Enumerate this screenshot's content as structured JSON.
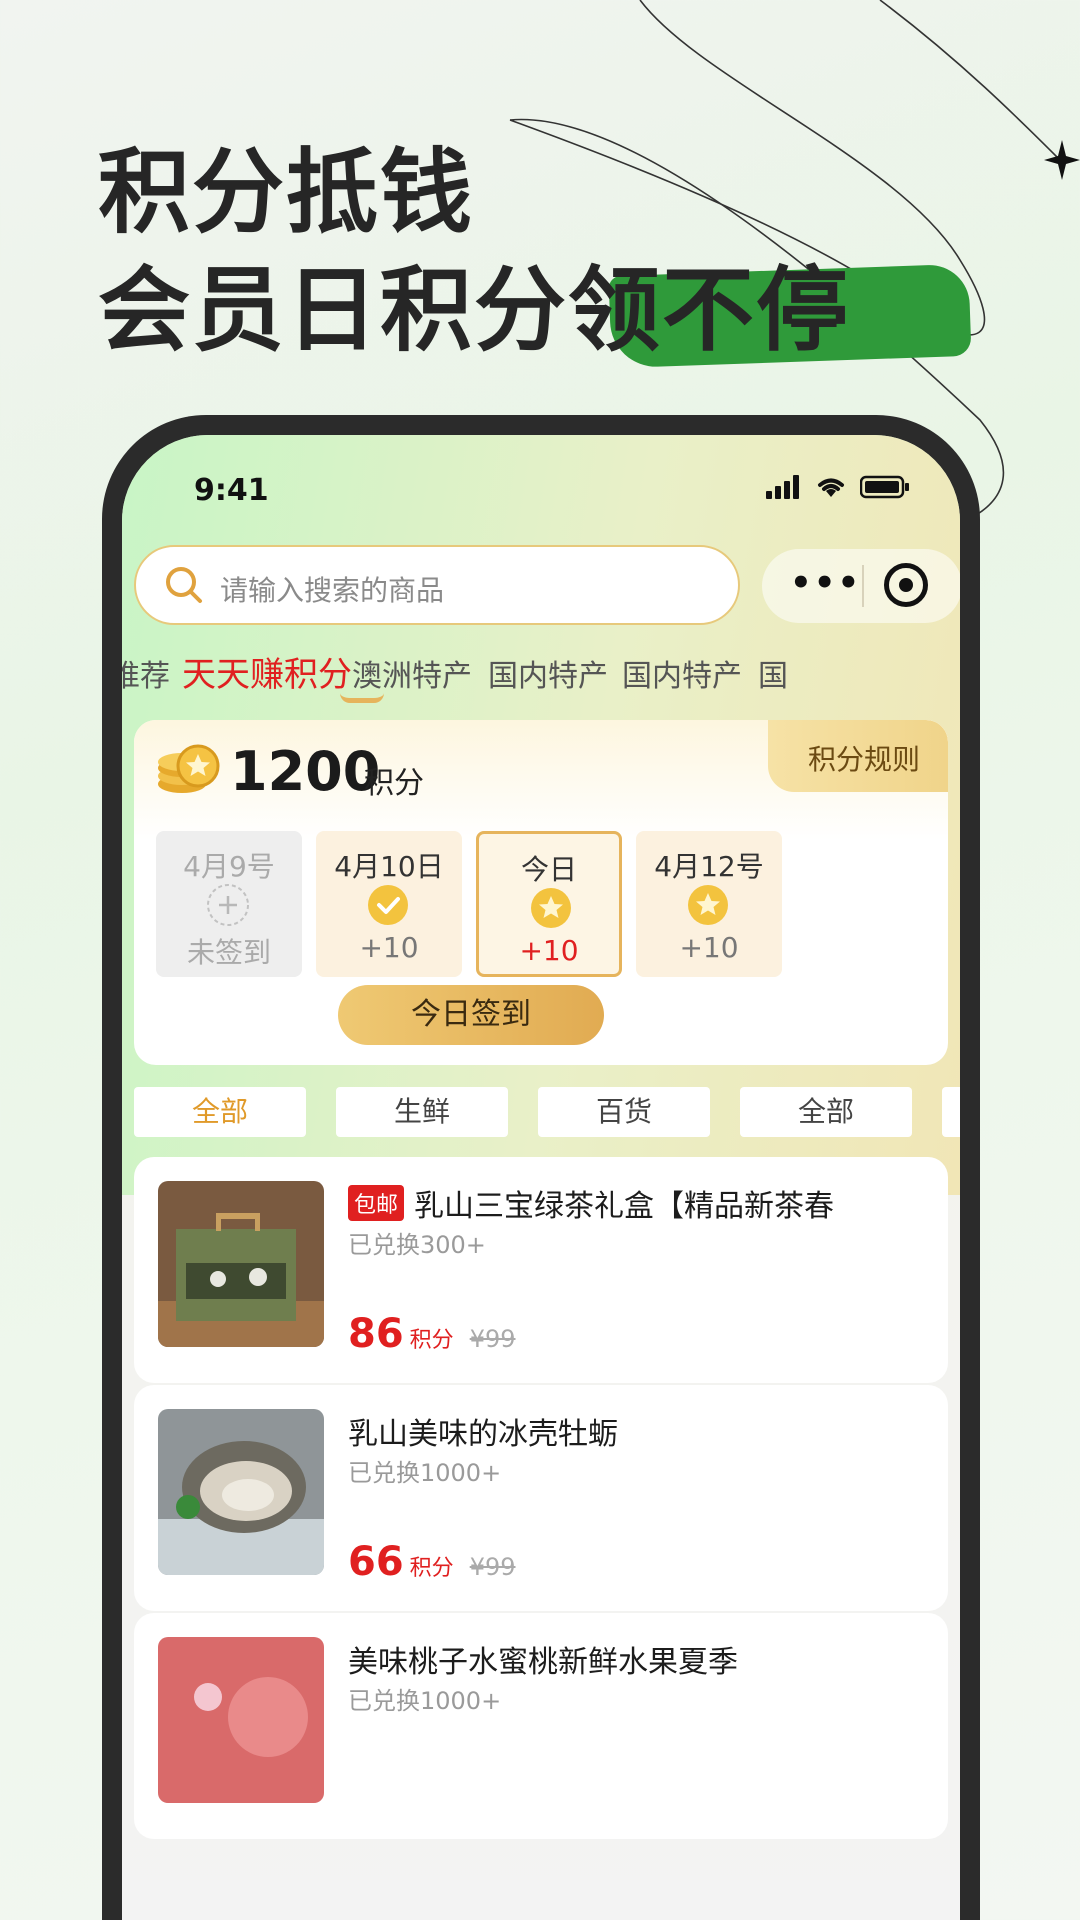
{
  "promo": {
    "headline_line1": "积分抵钱",
    "headline_line2": "会员日积分领不停"
  },
  "status_bar": {
    "time": "9:41"
  },
  "search": {
    "placeholder": "请输入搜索的商品",
    "icon": "search-icon"
  },
  "capsule": {
    "more": "•••",
    "target_icon": "target-icon"
  },
  "tabs": [
    {
      "label": "推荐"
    },
    {
      "label": "天天赚积分",
      "active": true
    },
    {
      "label": "澳洲特产"
    },
    {
      "label": "国内特产"
    },
    {
      "label": "国内特产"
    },
    {
      "label": "国"
    }
  ],
  "checkin": {
    "points": "1200",
    "points_unit": "积分",
    "rules": "积分规则",
    "days": [
      {
        "date": "4月9号",
        "reward": "未签到",
        "state": "missed",
        "icon": "plus-icon"
      },
      {
        "date": "4月10日",
        "reward": "+10",
        "state": "done",
        "icon": "check-icon"
      },
      {
        "date": "今日",
        "reward": "+10",
        "state": "today",
        "icon": "star-icon"
      },
      {
        "date": "4月12号",
        "reward": "+10",
        "state": "upcoming",
        "icon": "star-icon"
      }
    ],
    "sign_button": "今日签到"
  },
  "categories": [
    {
      "label": "全部",
      "active": true
    },
    {
      "label": "生鲜"
    },
    {
      "label": "百货"
    },
    {
      "label": "全部"
    }
  ],
  "products": [
    {
      "badge": "包邮",
      "title": "乳山三宝绿茶礼盒【精品新茶春",
      "sold": "已兑换300+",
      "price": "86",
      "price_unit": "积分",
      "original": "¥99"
    },
    {
      "badge": "",
      "title": "乳山美味的冰壳牡蛎",
      "sold": "已兑换1000+",
      "price": "66",
      "price_unit": "积分",
      "original": "¥99"
    },
    {
      "badge": "",
      "title": "美味桃子水蜜桃新鲜水果夏季",
      "sold": "已兑换1000+",
      "price": "",
      "price_unit": "",
      "original": ""
    }
  ],
  "colors": {
    "accent_red": "#e02020",
    "gold": "#e6b45c",
    "brush_green": "#2f9a3a"
  }
}
